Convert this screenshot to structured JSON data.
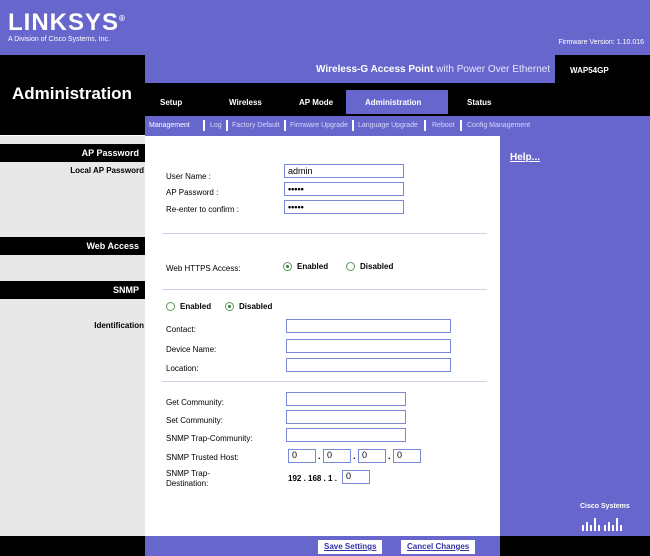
{
  "header": {
    "brand": "LINKSYS",
    "brand_mark": "®",
    "brand_sub": "A Division of Cisco Systems, Inc.",
    "firmware_label": "Firmware Version:",
    "firmware_value": "1.10.016",
    "product_bold": "Wireless-G Access Point",
    "product_rest": "with Power Over Ethernet",
    "model": "WAP54GP",
    "section_title": "Administration"
  },
  "tabs": [
    "Setup",
    "Wireless",
    "AP Mode",
    "Administration",
    "Status"
  ],
  "active_tab": "Administration",
  "subtabs": [
    "Management",
    "Log",
    "Factory Default",
    "Firmware Upgrade",
    "Language Upgrade",
    "Reboot",
    "Config Management"
  ],
  "active_subtab": "Management",
  "left": {
    "ap_password_hdr": "AP Password",
    "local_ap_password": "Local AP Password",
    "web_access_hdr": "Web Access",
    "snmp_hdr": "SNMP",
    "identification": "Identification"
  },
  "ap_password": {
    "user_name_label": "User Name :",
    "user_name_value": "admin",
    "password_label": "AP Password :",
    "password_value": "•••••",
    "reenter_label": "Re-enter to confirm :",
    "reenter_value": "•••••"
  },
  "web_access": {
    "https_label": "Web HTTPS Access:",
    "enabled": "Enabled",
    "disabled": "Disabled",
    "selected": "Enabled"
  },
  "snmp": {
    "enabled": "Enabled",
    "disabled": "Disabled",
    "selected": "Disabled",
    "contact_label": "Contact:",
    "contact_value": "",
    "device_name_label": "Device Name:",
    "device_name_value": "",
    "location_label": "Location:",
    "location_value": "",
    "get_community_label": "Get Community:",
    "get_community_value": "",
    "set_community_label": "Set Community:",
    "set_community_value": "",
    "trap_community_label": "SNMP Trap-Community:",
    "trap_community_value": "",
    "trusted_host_label": "SNMP Trusted Host:",
    "trusted_host": [
      "0",
      "0",
      "0",
      "0"
    ],
    "trap_destination_label_1": "SNMP Trap-",
    "trap_destination_label_2": "Destination:",
    "trap_destination_prefix": "192 . 168 . 1 .",
    "trap_destination_last": "0"
  },
  "help_link": "Help...",
  "cisco": "Cisco Systems",
  "buttons": {
    "save": "Save Settings",
    "cancel": "Cancel Changes"
  },
  "colors": {
    "brand_purple": "#6666cc",
    "black": "#000000",
    "input_border": "#7a88d8"
  }
}
